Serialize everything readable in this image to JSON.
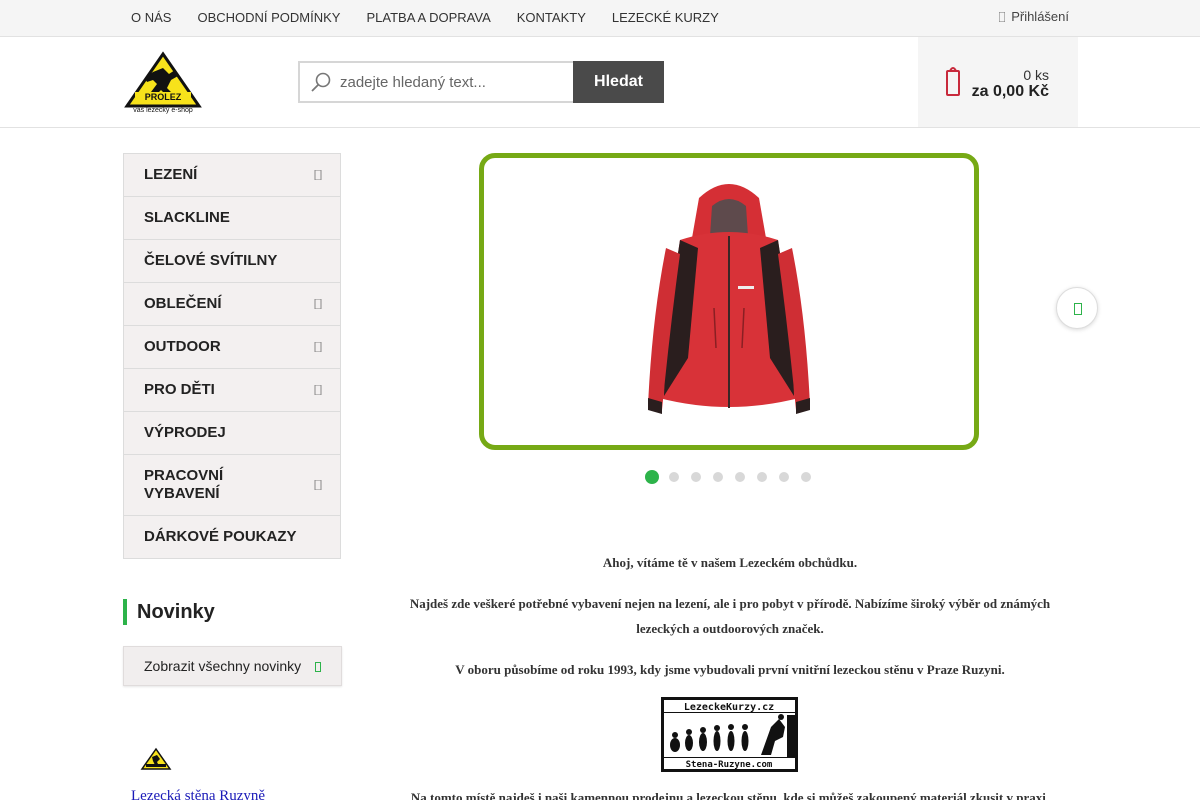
{
  "topnav": {
    "items": [
      "O NÁS",
      "OBCHODNÍ PODMÍNKY",
      "PLATBA A DOPRAVA",
      "KONTAKTY",
      "LEZECKÉ KURZY"
    ],
    "login": "Přihlášení"
  },
  "header": {
    "logo_text": "PROLEZ",
    "logo_tagline": "váš lezecký e-shop",
    "search_placeholder": "zadejte hledaný text...",
    "search_button": "Hledat",
    "cart_count": "0 ks",
    "cart_total": "za 0,00 Kč"
  },
  "categories": [
    {
      "label": "LEZENÍ",
      "has_sub": true
    },
    {
      "label": "SLACKLINE",
      "has_sub": false
    },
    {
      "label": "ČELOVÉ SVÍTILNY",
      "has_sub": false
    },
    {
      "label": "OBLEČENÍ",
      "has_sub": true
    },
    {
      "label": "OUTDOOR",
      "has_sub": true
    },
    {
      "label": "PRO DĚTI",
      "has_sub": true
    },
    {
      "label": "VÝPRODEJ",
      "has_sub": false
    },
    {
      "label": "PRACOVNÍ VYBAVENÍ",
      "has_sub": true
    },
    {
      "label": "DÁRKOVÉ POUKAZY",
      "has_sub": false
    }
  ],
  "news": {
    "title": "Novinky",
    "show_all": "Zobrazit všechny novinky"
  },
  "sidebar_link": "Lezecká stěna Ruzyně",
  "slider": {
    "slide_count": 8,
    "active_index": 0
  },
  "content": {
    "p1": "Ahoj, vítáme tě v našem Lezeckém obchůdku.",
    "p2": "Najdeš zde veškeré potřebné vybavení nejen na lezení, ale i pro pobyt v přírodě. Nabízíme široký výběr od známých lezeckých a outdoorových značek.",
    "p3": "V oboru působíme od roku 1993, kdy jsme vybudovali první vnitřní lezeckou stěnu v Praze Ruzyni.",
    "kurzy_logo_top": "LezeckeKurzy.cz",
    "kurzy_logo_bottom": "Stena-Ruzyne.com",
    "p4": "Na tomto místě najdeš i naši kamennou prodejnu a lezeckou stěnu, kde si můžeš zakoupený materiál zkusit v praxi."
  },
  "colors": {
    "accent_green": "#2db34a",
    "slider_border": "#76a915",
    "search_button_bg": "#4a4a4a",
    "cart_icon": "#c82a3c"
  }
}
